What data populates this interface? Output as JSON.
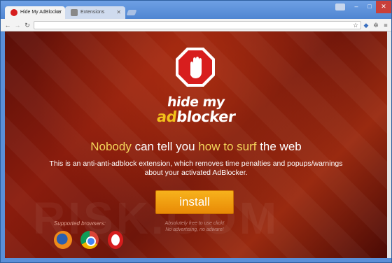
{
  "browser": {
    "tabs": [
      {
        "title": "Hide My AdBlocker",
        "active": true
      },
      {
        "title": "Extensions",
        "active": false
      }
    ],
    "window_controls": {
      "minimize": "–",
      "maximize": "□",
      "close": "✕"
    },
    "address": ""
  },
  "page": {
    "logo": {
      "line1": "hide my",
      "line2_prefix": "ad",
      "line2_suffix": "blocker"
    },
    "headline": {
      "p1": "Nobody",
      "p2": " can tell you ",
      "p3": "how to surf",
      "p4": " the web"
    },
    "description": "This is an anti-anti-adblock extension, which removes time penalties and popups/warnings about your activated AdBlocker.",
    "install_label": "install",
    "tagline_line1": "Absolutely free to use click!",
    "tagline_line2": "No advertising, no adware!",
    "supported_label": "Supported browsers:",
    "browsers": [
      "firefox",
      "chrome",
      "opera"
    ]
  },
  "colors": {
    "accent": "#f2c21b",
    "button": "#f0a010",
    "background": "#7a1a0c"
  }
}
